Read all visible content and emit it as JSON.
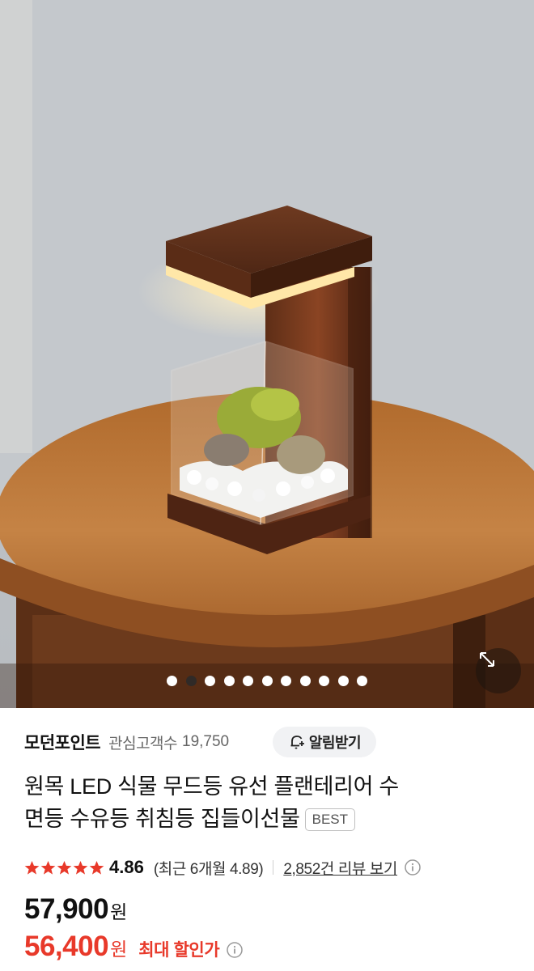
{
  "hero": {
    "image_alt": "원목 LED 식물 무드등 product photo",
    "carousel_total": 11,
    "carousel_active_index": 1,
    "expand_icon": "expand-arrows-icon"
  },
  "store": {
    "name": "모던포인트",
    "follower_label": "관심고객수",
    "follower_count": "19,750",
    "alert_button_label": "알림받기",
    "alert_icon": "bell-plus-icon"
  },
  "product": {
    "title_line1": "원목 LED 식물 무드등 유선 플랜테리어 수",
    "title_line2": "면등 수유등 취침등 집들이선물",
    "badge": "BEST"
  },
  "rating": {
    "stars": 5,
    "score": "4.86",
    "recent_text": "(최근 6개월 4.89)",
    "review_link": "2,852건 리뷰 보기",
    "star_color": "#e8392a"
  },
  "price": {
    "original": "57,900",
    "original_unit": "원",
    "sale": "56,400",
    "sale_unit": "원",
    "discount_label": "최대 할인가",
    "sale_color": "#e8392a"
  }
}
